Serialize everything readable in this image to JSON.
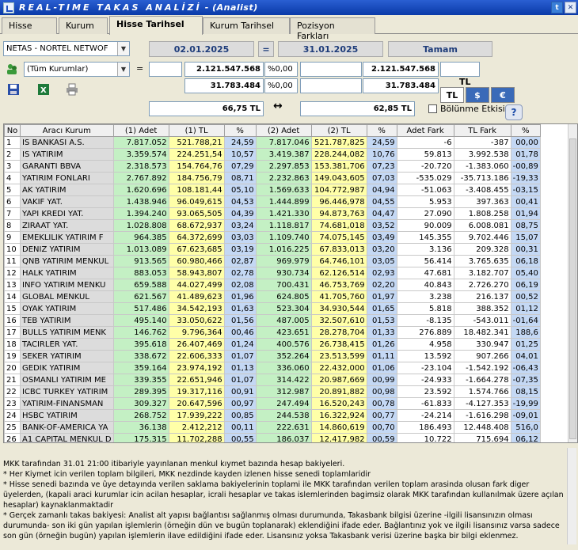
{
  "window": {
    "title": "REAL-TIME TAKAS ANALİZİ",
    "subtitle": "- (Analist)"
  },
  "tabs": [
    "Hisse",
    "Kurum",
    "Hisse Tarihsel",
    "Kurum Tarihsel",
    "Pozisyon Farkları"
  ],
  "active_tab": "Hisse Tarihsel",
  "controls": {
    "stock_select": "NETAS - NORTEL NETWOF",
    "start_date": "02.01.2025",
    "equals": "=",
    "end_date": "31.01.2025",
    "ok_button": "Tamam",
    "institution_select": "(Tüm Kurumlar)",
    "equals2": "=",
    "row1_total1": "2.121.547.568",
    "row1_pct1": "%0,00",
    "row1_total2": "2.121.547.568",
    "row2_total1": "31.783.484",
    "row2_pct1": "%0,00",
    "row2_total2": "31.783.484",
    "currency_label": "TL",
    "price1": "66,75 TL",
    "arrow": "↔",
    "price2": "62,85 TL",
    "currency_buttons": [
      "TL",
      "$",
      "€"
    ],
    "split_checkbox_label": "Bölünme Etkisi",
    "help_label": "?"
  },
  "table": {
    "headers": [
      "No",
      "Aracı Kurum",
      "(1) Adet",
      "(1) TL",
      "%",
      "(2) Adet",
      "(2) TL",
      "%",
      "Adet Fark",
      "TL Fark",
      "%"
    ],
    "rows": [
      [
        "1",
        "IS BANKASI A.S.",
        "7.817.052",
        "521.788,21",
        "24,59",
        "7.817.046",
        "521.787,825",
        "24,59",
        "-6",
        "-387",
        "00,00"
      ],
      [
        "2",
        "IS YATIRIM",
        "3.359.574",
        "224.251,54",
        "10,57",
        "3.419.387",
        "228.244,082",
        "10,76",
        "59.813",
        "3.992.538",
        "01,78"
      ],
      [
        "3",
        "GARANTI BBVA",
        "2.318.573",
        "154.764,76",
        "07,29",
        "2.297.853",
        "153.381,706",
        "07,23",
        "-20.720",
        "-1.383.060",
        "-00,89"
      ],
      [
        "4",
        "YATIRIM FONLARI",
        "2.767.892",
        "184.756,79",
        "08,71",
        "2.232.863",
        "149.043,605",
        "07,03",
        "-535.029",
        "-35.713.186",
        "-19,33"
      ],
      [
        "5",
        "AK YATIRIM",
        "1.620.696",
        "108.181,44",
        "05,10",
        "1.569.633",
        "104.772,987",
        "04,94",
        "-51.063",
        "-3.408.455",
        "-03,15"
      ],
      [
        "6",
        "VAKIF YAT.",
        "1.438.946",
        "96.049,615",
        "04,53",
        "1.444.899",
        "96.446,978",
        "04,55",
        "5.953",
        "397.363",
        "00,41"
      ],
      [
        "7",
        "YAPI KREDI YAT.",
        "1.394.240",
        "93.065,505",
        "04,39",
        "1.421.330",
        "94.873,763",
        "04,47",
        "27.090",
        "1.808.258",
        "01,94"
      ],
      [
        "8",
        "ZIRAAT YAT.",
        "1.028.808",
        "68.672,937",
        "03,24",
        "1.118.817",
        "74.681,018",
        "03,52",
        "90.009",
        "6.008.081",
        "08,75"
      ],
      [
        "9",
        "EMEKLILIK YATIRIM F",
        "964.385",
        "64.372,699",
        "03,03",
        "1.109.740",
        "74.075,145",
        "03,49",
        "145.355",
        "9.702.446",
        "15,07"
      ],
      [
        "10",
        "DENIZ YATIRIM",
        "1.013.089",
        "67.623,685",
        "03,19",
        "1.016.225",
        "67.833,013",
        "03,20",
        "3.136",
        "209.328",
        "00,31"
      ],
      [
        "11",
        "QNB YATIRIM MENKUL",
        "913.565",
        "60.980,466",
        "02,87",
        "969.979",
        "64.746,101",
        "03,05",
        "56.414",
        "3.765.635",
        "06,18"
      ],
      [
        "12",
        "HALK YATIRIM",
        "883.053",
        "58.943,807",
        "02,78",
        "930.734",
        "62.126,514",
        "02,93",
        "47.681",
        "3.182.707",
        "05,40"
      ],
      [
        "13",
        "INFO YATIRIM MENKU",
        "659.588",
        "44.027,499",
        "02,08",
        "700.431",
        "46.753,769",
        "02,20",
        "40.843",
        "2.726.270",
        "06,19"
      ],
      [
        "14",
        "GLOBAL MENKUL",
        "621.567",
        "41.489,623",
        "01,96",
        "624.805",
        "41.705,760",
        "01,97",
        "3.238",
        "216.137",
        "00,52"
      ],
      [
        "15",
        "OYAK YATIRIM",
        "517.486",
        "34.542,193",
        "01,63",
        "523.304",
        "34.930,544",
        "01,65",
        "5.818",
        "388.352",
        "01,12"
      ],
      [
        "16",
        "TEB YATIRIM",
        "495.140",
        "33.050,622",
        "01,56",
        "487.005",
        "32.507,610",
        "01,53",
        "-8.135",
        "-543.011",
        "-01,64"
      ],
      [
        "17",
        "BULLS YATIRIM MENK",
        "146.762",
        "9.796,364",
        "00,46",
        "423.651",
        "28.278,704",
        "01,33",
        "276.889",
        "18.482.341",
        "188,6"
      ],
      [
        "18",
        "TACIRLER YAT.",
        "395.618",
        "26.407,469",
        "01,24",
        "400.576",
        "26.738,415",
        "01,26",
        "4.958",
        "330.947",
        "01,25"
      ],
      [
        "19",
        "SEKER YATIRIM",
        "338.672",
        "22.606,333",
        "01,07",
        "352.264",
        "23.513,599",
        "01,11",
        "13.592",
        "907.266",
        "04,01"
      ],
      [
        "20",
        "GEDIK YATIRIM",
        "359.164",
        "23.974,192",
        "01,13",
        "336.060",
        "22.432,000",
        "01,06",
        "-23.104",
        "-1.542.192",
        "-06,43"
      ],
      [
        "21",
        "OSMANLI YATIRIM ME",
        "339.355",
        "22.651,946",
        "01,07",
        "314.422",
        "20.987,669",
        "00,99",
        "-24.933",
        "-1.664.278",
        "-07,35"
      ],
      [
        "22",
        "ICBC TURKEY YATIRIM",
        "289.395",
        "19.317,116",
        "00,91",
        "312.987",
        "20.891,882",
        "00,98",
        "23.592",
        "1.574.766",
        "08,15"
      ],
      [
        "23",
        "YATIRIM-FINANSMAN",
        "309.327",
        "20.647,596",
        "00,97",
        "247.494",
        "16.520,243",
        "00,78",
        "-61.833",
        "-4.127.353",
        "-19,99"
      ],
      [
        "24",
        "HSBC YATIRIM",
        "268.752",
        "17.939,222",
        "00,85",
        "244.538",
        "16.322,924",
        "00,77",
        "-24.214",
        "-1.616.298",
        "-09,01"
      ],
      [
        "25",
        "BANK-OF-AMERICA YA",
        "36.138",
        "2.412,212",
        "00,11",
        "222.631",
        "14.860,619",
        "00,70",
        "186.493",
        "12.448.408",
        "516,0"
      ],
      [
        "26",
        "A1 CAPITAL MENKUL D",
        "175.315",
        "11.702,288",
        "00,55",
        "186.037",
        "12.417,982",
        "00,59",
        "10.722",
        "715.694",
        "06,12"
      ]
    ]
  },
  "notes": [
    "MKK tarafından 31.01 21:00 itibariyle yayınlanan menkul kıymet bazında hesap bakiyeleri.",
    "* Her Kiymet icin verilen toplam bilgileri, MKK nezdinde kayden izlenen hisse senedi toplamlaridir",
    "* Hisse senedi bazında ve ûye detayında verilen saklama bakiyelerinin toplami ile MKK tarafından verilen toplam arasinda olusan fark diger üyelerden, (kapali araci kurumlar icin acilan hesaplar, icrali hesaplar ve takas islemlerinden bagimsiz olarak MKK tarafından kullanılmak üzere açılan hesaplar) kaynaklanmaktadir",
    "* Gerçek zamanlı takas bakiyesi: Analist alt yapısı bağlantısı sağlanmış olması durumunda, Takasbank bilgisi üzerine -ilgili lisansınızın olması durumunda- son iki gün yapılan işlemlerin (örneğin dün ve bugün toplanarak) eklendiğini ifade eder. Bağlantınız yok ve ilgili lisansınız varsa sadece son gün (örneğin bugün) yapılan işlemlerin ilave edildiğini ifade eder. Lisansınız yoksa Takasbank verisi üzerine başka bir bilgi eklenmez."
  ]
}
